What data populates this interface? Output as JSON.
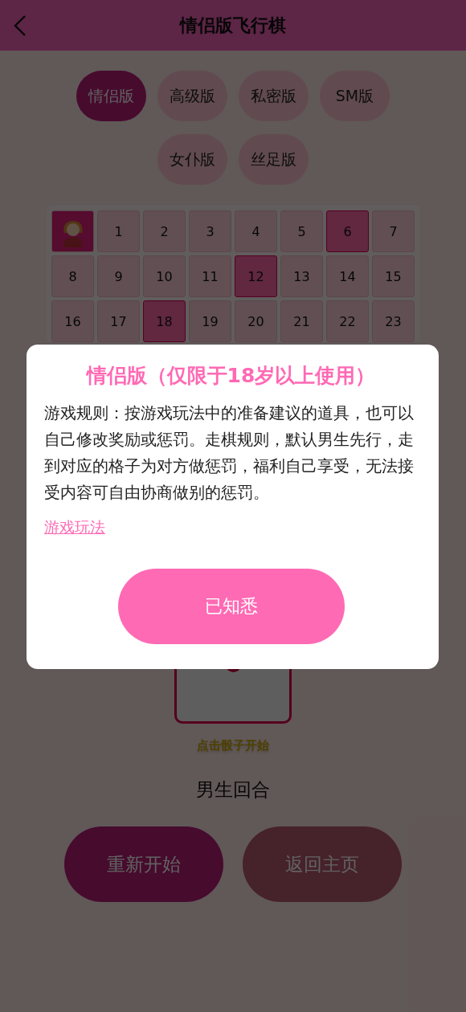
{
  "header": {
    "title": "情侣版飞行棋"
  },
  "versions": [
    {
      "label": "情侣版",
      "selected": true
    },
    {
      "label": "高级版",
      "selected": false
    },
    {
      "label": "私密版",
      "selected": false
    },
    {
      "label": "SM版",
      "selected": false
    },
    {
      "label": "女仆版",
      "selected": false
    },
    {
      "label": "丝足版",
      "selected": false
    }
  ],
  "board": {
    "cells": [
      {
        "kind": "player",
        "highlighted": false
      },
      {
        "kind": "number",
        "label": "1",
        "highlighted": false
      },
      {
        "kind": "number",
        "label": "2",
        "highlighted": false
      },
      {
        "kind": "number",
        "label": "3",
        "highlighted": false
      },
      {
        "kind": "number",
        "label": "4",
        "highlighted": false
      },
      {
        "kind": "number",
        "label": "5",
        "highlighted": false
      },
      {
        "kind": "number",
        "label": "6",
        "highlighted": true
      },
      {
        "kind": "number",
        "label": "7",
        "highlighted": false
      },
      {
        "kind": "number",
        "label": "8",
        "highlighted": false
      },
      {
        "kind": "number",
        "label": "9",
        "highlighted": false
      },
      {
        "kind": "number",
        "label": "10",
        "highlighted": false
      },
      {
        "kind": "number",
        "label": "11",
        "highlighted": false
      },
      {
        "kind": "number",
        "label": "12",
        "highlighted": true
      },
      {
        "kind": "number",
        "label": "13",
        "highlighted": false
      },
      {
        "kind": "number",
        "label": "14",
        "highlighted": false
      },
      {
        "kind": "number",
        "label": "15",
        "highlighted": false
      },
      {
        "kind": "number",
        "label": "16",
        "highlighted": false
      },
      {
        "kind": "number",
        "label": "17",
        "highlighted": false
      },
      {
        "kind": "number",
        "label": "18",
        "highlighted": true
      },
      {
        "kind": "number",
        "label": "19",
        "highlighted": false
      },
      {
        "kind": "number",
        "label": "20",
        "highlighted": false
      },
      {
        "kind": "number",
        "label": "21",
        "highlighted": false
      },
      {
        "kind": "number",
        "label": "22",
        "highlighted": false
      },
      {
        "kind": "number",
        "label": "23",
        "highlighted": false
      }
    ]
  },
  "hint": "点击骰子开始",
  "turn": "男生回合",
  "buttons": [
    {
      "label": "重新开始",
      "kind": "primary"
    },
    {
      "label": "返回主页",
      "kind": "secondary"
    }
  ],
  "dialog": {
    "title": "情侣版（仅限于18岁以上使用）",
    "rules": "游戏规则：按游戏玩法中的准备建议的道具，也可以自己修改奖励或惩罚。走棋规则，默认男生先行，走到对应的格子为对方做惩罚，福利自己享受，无法接受内容可自由协商做别的惩罚。",
    "link": "游戏玩法",
    "confirm": "已知悉"
  }
}
